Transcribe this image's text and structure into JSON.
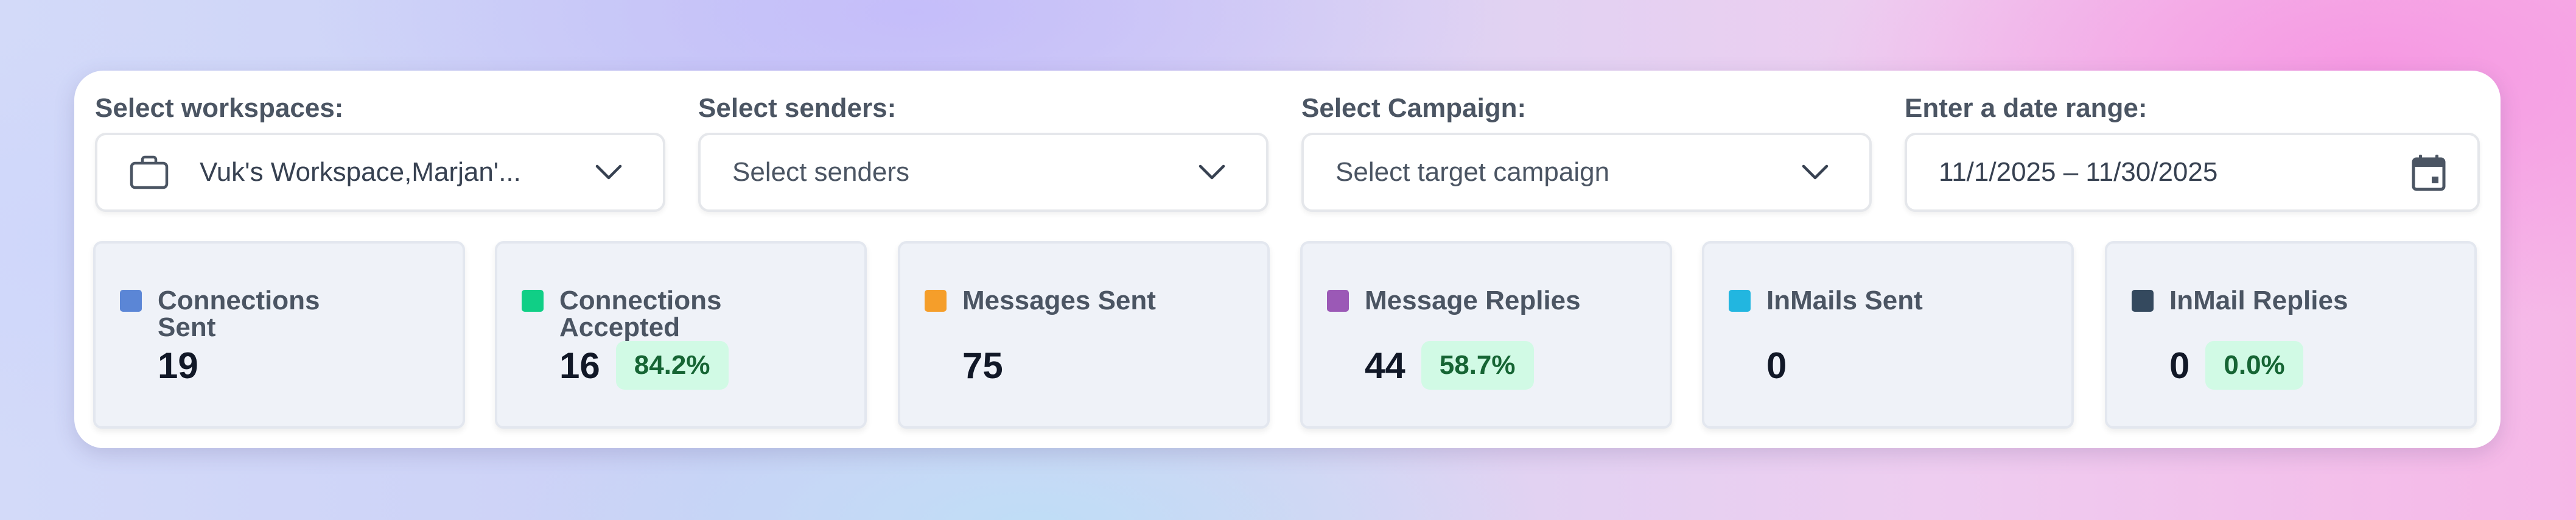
{
  "filters": {
    "workspaces": {
      "label": "Select workspaces:",
      "value": "Vuk's Workspace,Marjan'..."
    },
    "senders": {
      "label": "Select senders:",
      "placeholder": "Select senders"
    },
    "campaign": {
      "label": "Select Campaign:",
      "placeholder": "Select target campaign"
    },
    "date_range": {
      "label": "Enter a date range:",
      "value": "11/1/2025 – 11/30/2025"
    }
  },
  "stats": [
    {
      "label": "Connections Sent",
      "value": "19",
      "badge": "",
      "color": "#5b86d6"
    },
    {
      "label": "Connections Accepted",
      "value": "16",
      "badge": "84.2%",
      "color": "#10cf86"
    },
    {
      "label": "Messages Sent",
      "value": "75",
      "badge": "",
      "color": "#f59e2a"
    },
    {
      "label": "Message Replies",
      "value": "44",
      "badge": "58.7%",
      "color": "#9b59b6"
    },
    {
      "label": "InMails Sent",
      "value": "0",
      "badge": "",
      "color": "#22b6e0"
    },
    {
      "label": "InMail Replies",
      "value": "0",
      "badge": "0.0%",
      "color": "#34495e"
    }
  ],
  "icons": {
    "workspace": "briefcase-icon",
    "dropdown": "chevron-down-icon",
    "date": "calendar-icon"
  },
  "colors": {
    "badge_bg": "#d1fae5",
    "badge_text": "#166534",
    "card_bg": "#eff2f8"
  }
}
